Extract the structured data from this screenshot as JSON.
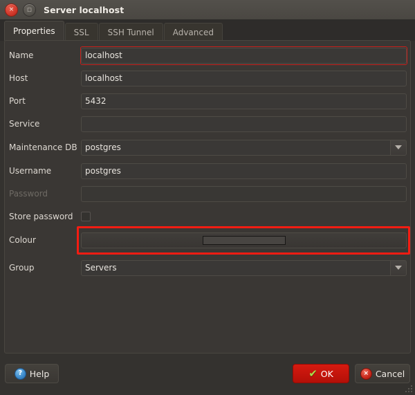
{
  "window": {
    "title": "Server localhost",
    "close_icon": "close-circle-icon",
    "close_glyph": "×",
    "maximize_icon": "maximize-square-icon",
    "maximize_glyph": "□"
  },
  "tabs": [
    {
      "label": "Properties",
      "active": true
    },
    {
      "label": "SSL",
      "active": false
    },
    {
      "label": "SSH Tunnel",
      "active": false
    },
    {
      "label": "Advanced",
      "active": false
    }
  ],
  "form": {
    "fields": [
      {
        "label": "Name",
        "type": "text",
        "value": "localhost",
        "placeholder": "",
        "focused": true,
        "highlighted": true,
        "disabled": false
      },
      {
        "label": "Host",
        "type": "text",
        "value": "localhost",
        "placeholder": "",
        "focused": false,
        "highlighted": false,
        "disabled": false
      },
      {
        "label": "Port",
        "type": "text",
        "value": "5432",
        "placeholder": "",
        "focused": false,
        "highlighted": false,
        "disabled": false
      },
      {
        "label": "Service",
        "type": "text",
        "value": "",
        "placeholder": "",
        "focused": false,
        "highlighted": false,
        "disabled": false
      },
      {
        "label": "Maintenance DB",
        "type": "combo",
        "value": "postgres",
        "dropdown_icon": "chevron-down-icon",
        "focused": false,
        "highlighted": false,
        "disabled": false
      },
      {
        "label": "Username",
        "type": "text",
        "value": "postgres",
        "placeholder": "",
        "focused": false,
        "highlighted": false,
        "disabled": false
      },
      {
        "label": "Password",
        "type": "password",
        "value": "",
        "placeholder": "",
        "focused": false,
        "highlighted": false,
        "disabled": true
      },
      {
        "label": "Store password",
        "type": "checkbox",
        "checked": false,
        "focused": false,
        "highlighted": false,
        "disabled": false
      },
      {
        "label": "Colour",
        "type": "colour",
        "swatch_colour": "#484542",
        "focused": false,
        "highlighted": true,
        "disabled": false
      },
      {
        "label": "Group",
        "type": "combo",
        "value": "Servers",
        "dropdown_icon": "chevron-down-icon",
        "focused": false,
        "highlighted": false,
        "disabled": false
      }
    ]
  },
  "buttons": {
    "help": {
      "label": "Help",
      "icon": "help-circle-icon",
      "glyph": "?"
    },
    "ok": {
      "label": "OK",
      "icon": "checkmark-icon",
      "glyph": "✔"
    },
    "cancel": {
      "label": "Cancel",
      "icon": "cancel-circle-icon",
      "glyph": "×"
    }
  },
  "colors": {
    "highlight": "#f41c12",
    "accent_ok": "#d61a10",
    "panel_bg": "#3a3734",
    "titlebar_bg": "#4d4a45"
  }
}
